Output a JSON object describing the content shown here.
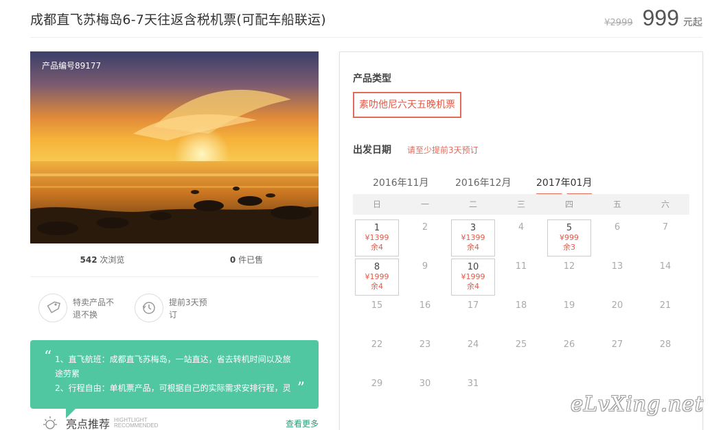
{
  "header": {
    "title": "成都直飞苏梅岛6-7天往返含税机票(可配车船联运)",
    "old_price": "¥2999",
    "price": "999",
    "price_unit": "元起"
  },
  "product": {
    "number_label": "产品编号89177",
    "views_count": "542",
    "views_label": " 次浏览",
    "sold_count": "0",
    "sold_label": " 件已售"
  },
  "features": [
    {
      "icon": "tag-icon",
      "text": "特卖产品不\n退不换"
    },
    {
      "icon": "clock-icon",
      "text": "提前3天预\n订"
    }
  ],
  "highlights": {
    "line1": "1、直飞航班：成都直飞苏梅岛，一站直达，省去转机时间以及旅途劳累",
    "line2": "2、行程自由：单机票产品，可根据自己的实际需求安排行程，灵",
    "title": "亮点推荐",
    "sub1": "HIGHTLIGHT",
    "sub2": "RECOMMENDED",
    "more": "查看更多"
  },
  "booking": {
    "type_label": "产品类型",
    "type_option": "素叻他尼六天五晚机票",
    "date_label": "出发日期",
    "date_note": "请至少提前3天预订",
    "months": [
      "2016年11月",
      "2016年12月",
      "2017年01月"
    ],
    "active_month": 2,
    "weekdays": [
      "日",
      "一",
      "二",
      "三",
      "四",
      "五",
      "六"
    ],
    "days": [
      {
        "d": "1",
        "price": "¥1399",
        "stock": "余4"
      },
      {
        "d": "2"
      },
      {
        "d": "3",
        "price": "¥1399",
        "stock": "余4"
      },
      {
        "d": "4"
      },
      {
        "d": "5",
        "price": "¥999",
        "stock": "余3"
      },
      {
        "d": "6"
      },
      {
        "d": "7"
      },
      {
        "d": "8",
        "price": "¥1999",
        "stock": "余4"
      },
      {
        "d": "9"
      },
      {
        "d": "10",
        "price": "¥1999",
        "stock": "余4"
      },
      {
        "d": "11"
      },
      {
        "d": "12"
      },
      {
        "d": "13"
      },
      {
        "d": "14"
      },
      {
        "d": "15"
      },
      {
        "d": "16"
      },
      {
        "d": "17"
      },
      {
        "d": "18"
      },
      {
        "d": "19"
      },
      {
        "d": "20"
      },
      {
        "d": "21"
      },
      {
        "d": "22"
      },
      {
        "d": "23"
      },
      {
        "d": "24"
      },
      {
        "d": "25"
      },
      {
        "d": "26"
      },
      {
        "d": "27"
      },
      {
        "d": "28"
      },
      {
        "d": "29"
      },
      {
        "d": "30"
      },
      {
        "d": "31"
      }
    ]
  },
  "watermark": "eLvXing.net",
  "colors": {
    "accent": "#e36a5a",
    "highlight_bg": "#50c7a0",
    "link": "#2b9c77"
  }
}
